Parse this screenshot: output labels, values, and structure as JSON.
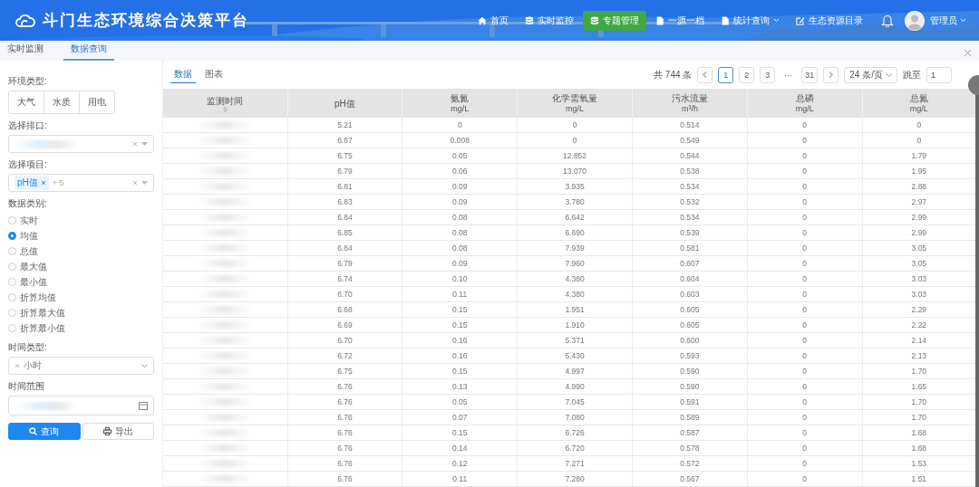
{
  "header": {
    "title": "斗门生态环境综合决策平台",
    "nav": [
      {
        "label": "首页",
        "kind": "home",
        "selected": false,
        "dropdown": false
      },
      {
        "label": "实时监控",
        "kind": "database",
        "selected": false,
        "dropdown": false
      },
      {
        "label": "专题管理",
        "kind": "database",
        "selected": true,
        "dropdown": false
      },
      {
        "label": "一源一档",
        "kind": "file",
        "selected": false,
        "dropdown": false
      },
      {
        "label": "统计查询",
        "kind": "file",
        "selected": false,
        "dropdown": true
      },
      {
        "label": "生态资源目录",
        "kind": "edit",
        "selected": false,
        "dropdown": false
      }
    ],
    "user": "管理员"
  },
  "tabs": [
    {
      "label": "实时监测",
      "selected": false
    },
    {
      "label": "数据查询",
      "selected": true
    }
  ],
  "sidebar": {
    "env_type": {
      "label": "环境类型:",
      "options": [
        {
          "label": "大气",
          "selected": false
        },
        {
          "label": "水质",
          "selected": false
        },
        {
          "label": "用电",
          "selected": false
        }
      ]
    },
    "outlet": {
      "label": "选择排口:"
    },
    "items": {
      "label": "选择项目:",
      "tag": "pH值",
      "more": "+ 5"
    },
    "data_type": {
      "label": "数据类别:",
      "options": [
        {
          "label": "实时",
          "selected": false
        },
        {
          "label": "均值",
          "selected": true
        },
        {
          "label": "总值",
          "selected": false
        },
        {
          "label": "最大值",
          "selected": false
        },
        {
          "label": "最小值",
          "selected": false
        },
        {
          "label": "折算均值",
          "selected": false
        },
        {
          "label": "折算最大值",
          "selected": false
        },
        {
          "label": "折算最小值",
          "selected": false
        }
      ]
    },
    "time_type": {
      "label": "时间类型:",
      "value": "小时"
    },
    "time_range": {
      "label": "时间范围"
    },
    "buttons": [
      {
        "label": "查询",
        "kind": "primary"
      },
      {
        "label": "导出",
        "kind": "default"
      }
    ]
  },
  "view_tabs": [
    {
      "label": "数据",
      "selected": true
    },
    {
      "label": "图表",
      "selected": false
    }
  ],
  "pagination": {
    "total": "共 744 条",
    "pages": [
      {
        "label": "1",
        "selected": true
      },
      {
        "label": "2",
        "selected": false
      },
      {
        "label": "3",
        "selected": false
      },
      {
        "label": "···",
        "selected": false
      },
      {
        "label": "31",
        "selected": false
      }
    ],
    "page_size": "24 条/页",
    "jump_label": "跳至",
    "jump_value": "1"
  },
  "table": {
    "columns": [
      {
        "name": "监测时间",
        "sortable": true
      },
      {
        "name": "pH值",
        "sortable": false
      },
      {
        "name": "氨氮",
        "unit": "mg/L",
        "sortable": false
      },
      {
        "name": "化学需氧量",
        "unit": "mg/L",
        "sortable": false
      },
      {
        "name": "污水流量",
        "unit": "m³/h",
        "sortable": false
      },
      {
        "name": "总磷",
        "unit": "mg/L",
        "sortable": false
      },
      {
        "name": "总氮",
        "unit": "mg/L",
        "sortable": false
      }
    ],
    "rows": [
      [
        "",
        "5.21",
        "0",
        "0",
        "0.514",
        "0",
        "0"
      ],
      [
        "",
        "6.67",
        "0.008",
        "0",
        "0.549",
        "0",
        "0"
      ],
      [
        "",
        "6.75",
        "0.05",
        "12.852",
        "0.544",
        "0",
        "1.79"
      ],
      [
        "",
        "6.79",
        "0.06",
        "13.070",
        "0.538",
        "0",
        "1.95"
      ],
      [
        "",
        "6.81",
        "0.09",
        "3.935",
        "0.534",
        "0",
        "2.88"
      ],
      [
        "",
        "6.83",
        "0.09",
        "3.780",
        "0.532",
        "0",
        "2.97"
      ],
      [
        "",
        "6.84",
        "0.08",
        "6.642",
        "0.534",
        "0",
        "2.99"
      ],
      [
        "",
        "6.85",
        "0.08",
        "6.690",
        "0.539",
        "0",
        "2.99"
      ],
      [
        "",
        "6.84",
        "0.08",
        "7.939",
        "0.581",
        "0",
        "3.05"
      ],
      [
        "",
        "6.79",
        "0.09",
        "7.960",
        "0.607",
        "0",
        "3.05"
      ],
      [
        "",
        "6.74",
        "0.10",
        "4.380",
        "0.604",
        "0",
        "3.03"
      ],
      [
        "",
        "6.70",
        "0.11",
        "4.380",
        "0.603",
        "0",
        "3.03"
      ],
      [
        "",
        "6.68",
        "0.15",
        "1.951",
        "0.605",
        "0",
        "2.29"
      ],
      [
        "",
        "6.69",
        "0.15",
        "1.910",
        "0.605",
        "0",
        "2.22"
      ],
      [
        "",
        "6.70",
        "0.16",
        "5.371",
        "0.600",
        "0",
        "2.14"
      ],
      [
        "",
        "6.72",
        "0.16",
        "5.430",
        "0.593",
        "0",
        "2.13"
      ],
      [
        "",
        "6.75",
        "0.15",
        "4.997",
        "0.590",
        "0",
        "1.70"
      ],
      [
        "",
        "6.76",
        "0.13",
        "4.990",
        "0.590",
        "0",
        "1.65"
      ],
      [
        "",
        "6.76",
        "0.05",
        "7.045",
        "0.591",
        "0",
        "1.70"
      ],
      [
        "",
        "6.76",
        "0.07",
        "7.080",
        "0.589",
        "0",
        "1.70"
      ],
      [
        "",
        "6.76",
        "0.15",
        "6.726",
        "0.587",
        "0",
        "1.68"
      ],
      [
        "",
        "6.76",
        "0.14",
        "6.720",
        "0.578",
        "0",
        "1.68"
      ],
      [
        "",
        "6.76",
        "0.12",
        "7.271",
        "0.572",
        "0",
        "1.53"
      ],
      [
        "",
        "6.76",
        "0.11",
        "7.280",
        "0.567",
        "0",
        "1.51"
      ]
    ]
  }
}
